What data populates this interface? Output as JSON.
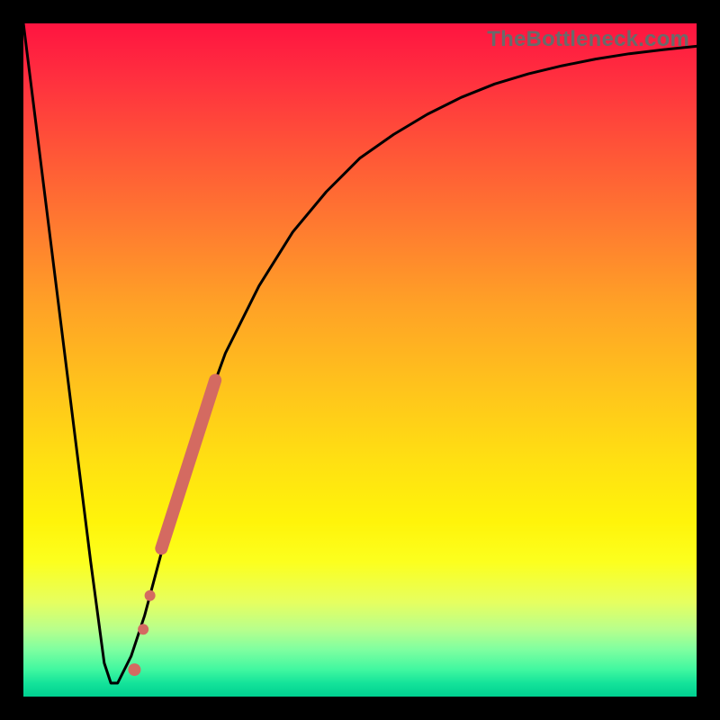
{
  "watermark": "TheBottleneck.com",
  "colors": {
    "frame": "#000000",
    "curve": "#000000",
    "marker": "#d46a61"
  },
  "chart_data": {
    "type": "line",
    "title": "",
    "xlabel": "",
    "ylabel": "",
    "xlim": [
      0,
      100
    ],
    "ylim": [
      0,
      100
    ],
    "grid": false,
    "series": [
      {
        "name": "bottleneck-curve",
        "x": [
          0,
          5,
          10,
          12,
          13,
          14,
          16,
          18,
          22,
          26,
          30,
          35,
          40,
          45,
          50,
          55,
          60,
          65,
          70,
          75,
          80,
          85,
          90,
          95,
          100
        ],
        "y": [
          100,
          60,
          20,
          5,
          2,
          2,
          6,
          12,
          27,
          40,
          51,
          61,
          69,
          75,
          80,
          83.5,
          86.5,
          89,
          91,
          92.5,
          93.7,
          94.7,
          95.5,
          96.1,
          96.6
        ]
      }
    ],
    "markers": {
      "name": "highlight-points",
      "color": "#d46a61",
      "segment": {
        "x1": 20.5,
        "y1": 22,
        "x2": 28.5,
        "y2": 47,
        "width": 14
      },
      "dots": [
        {
          "x": 18.8,
          "y": 15,
          "r": 6
        },
        {
          "x": 17.8,
          "y": 10,
          "r": 6
        },
        {
          "x": 16.5,
          "y": 4,
          "r": 7
        }
      ]
    }
  }
}
